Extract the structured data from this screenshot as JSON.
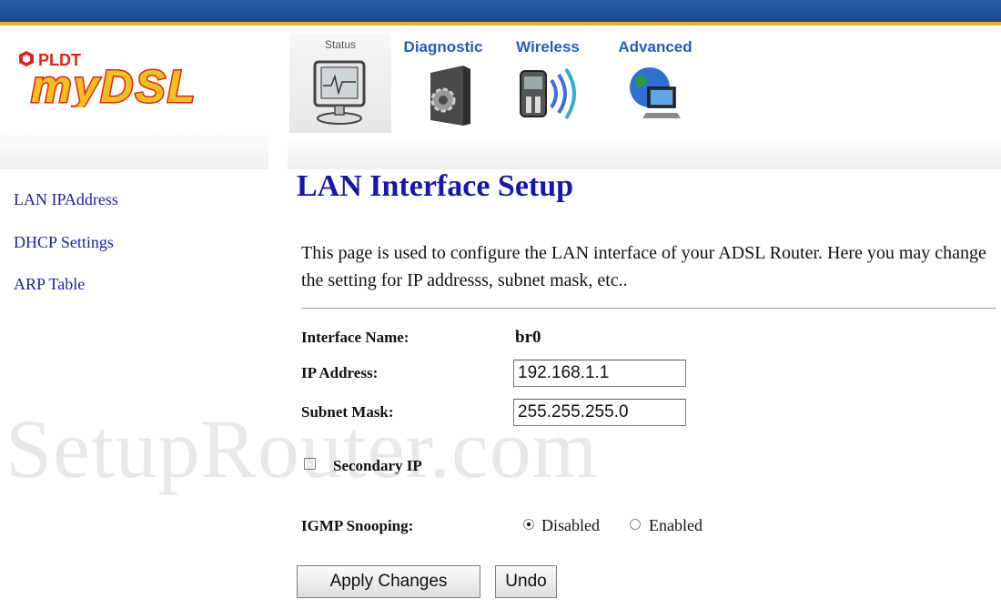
{
  "brand": {
    "logo_text_top": "PLDT",
    "logo_text_main": "myDSL",
    "accent": "#e2231a",
    "logo_yellow": "#f2c21a"
  },
  "nav": {
    "tabs": [
      {
        "label": "Status",
        "icon": "monitor-icon",
        "active": true
      },
      {
        "label": "Diagnostic",
        "icon": "gear-tower-icon",
        "active": false
      },
      {
        "label": "Wireless",
        "icon": "wireless-icon",
        "active": false
      },
      {
        "label": "Advanced",
        "icon": "globe-computer-icon",
        "active": false
      }
    ]
  },
  "sidebar": {
    "items": [
      {
        "label": "LAN IPAddress"
      },
      {
        "label": "DHCP Settings"
      },
      {
        "label": "ARP Table"
      }
    ]
  },
  "main": {
    "title": "LAN Interface Setup",
    "intro": "This page is used to configure the LAN interface of your ADSL Router. Here you may change the setting for IP addresss, subnet mask, etc..",
    "interface_name_label": "Interface Name:",
    "interface_name_value": "br0",
    "ip_label": "IP Address:",
    "ip_value": "192.168.1.1",
    "subnet_label": "Subnet Mask:",
    "subnet_value": "255.255.255.0",
    "secondary_ip_label": "Secondary IP",
    "secondary_ip_checked": false,
    "igmp_label": "IGMP Snooping:",
    "igmp_options": [
      {
        "label": "Disabled",
        "selected": true
      },
      {
        "label": "Enabled",
        "selected": false
      }
    ],
    "apply_label": "Apply Changes",
    "undo_label": "Undo"
  },
  "watermark": "SetupRouter.com"
}
